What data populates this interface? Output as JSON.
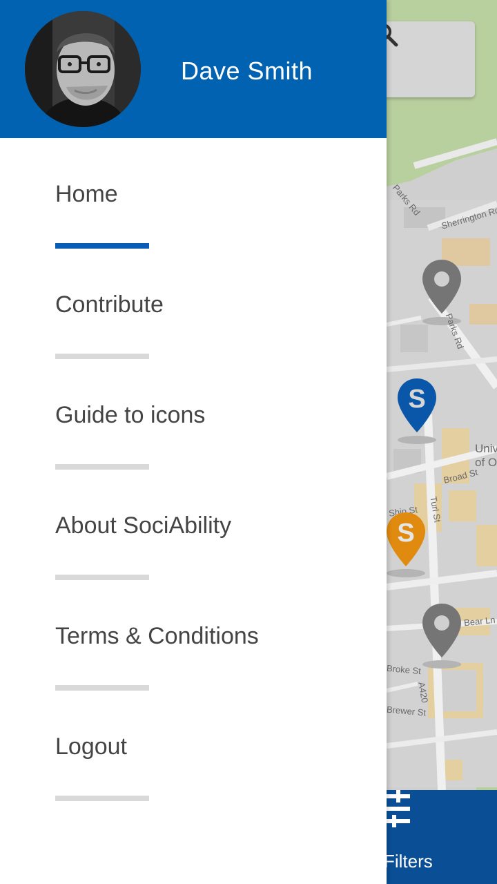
{
  "user": {
    "name": "Dave Smith"
  },
  "menu": {
    "items": [
      {
        "label": "Home",
        "active": true
      },
      {
        "label": "Contribute",
        "active": false
      },
      {
        "label": "Guide to icons",
        "active": false
      },
      {
        "label": "About SociAbility",
        "active": false
      },
      {
        "label": "Terms & Conditions",
        "active": false
      },
      {
        "label": "Logout",
        "active": false
      }
    ]
  },
  "map": {
    "street_labels": [
      "Sherrington Rd",
      "Parks Rd",
      "Parks Rd",
      "Broad St",
      "Turl St",
      "Ship St",
      "Bear Ln",
      "Broke St",
      "Brewer St",
      "A420",
      "Univ",
      "of O"
    ],
    "pins": [
      {
        "type": "place",
        "color": "#757575"
      },
      {
        "type": "sociability",
        "letter": "S",
        "color": "#0a56a8"
      },
      {
        "type": "sociability",
        "letter": "S",
        "color": "#e08a10"
      },
      {
        "type": "place",
        "color": "#757575"
      }
    ]
  },
  "toolbar": {
    "filters_label": "Filters"
  },
  "colors": {
    "header_blue": "#0062b1",
    "active_underline": "#0a5db5",
    "filters_bar": "#0a4f95"
  },
  "icons": [
    "search-icon",
    "filters-icon",
    "map-pin-icon"
  ]
}
